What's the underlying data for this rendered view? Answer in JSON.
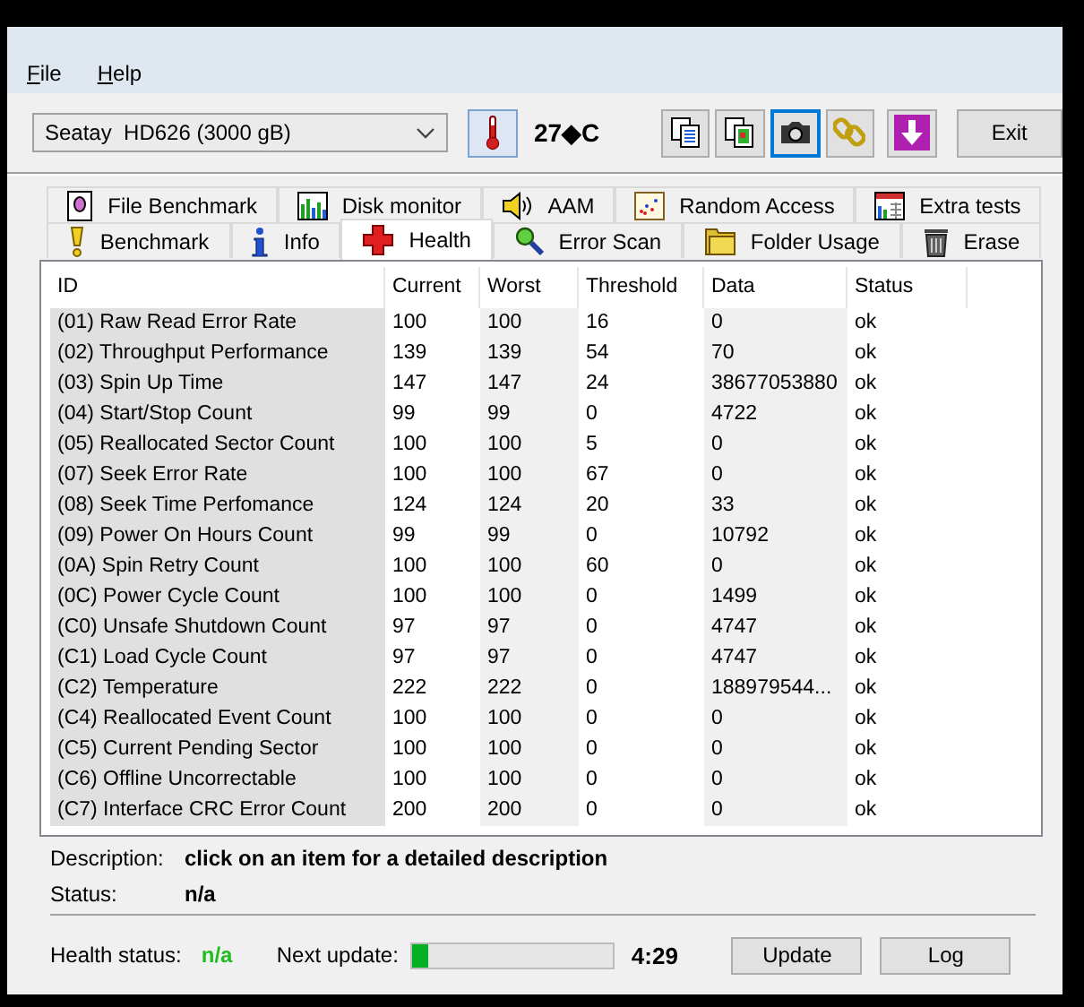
{
  "menu": [
    {
      "label": "File"
    },
    {
      "label": "Help"
    }
  ],
  "toolbar": {
    "drive": "Seatay  HD626 (3000 gB)",
    "temperature": "27◆C",
    "tools": [
      {
        "focused": false
      },
      {
        "focused": false
      },
      {
        "focused": true
      },
      {
        "focused": false
      },
      {
        "focused": false
      }
    ],
    "exit": "Exit"
  },
  "tab_rows": [
    {
      "tabs": [
        {
          "label": "File Benchmark",
          "selected": false
        },
        {
          "label": "Disk monitor",
          "selected": false
        },
        {
          "label": "AAM",
          "selected": false
        },
        {
          "label": "Random Access",
          "selected": false
        },
        {
          "label": "Extra tests",
          "selected": false
        }
      ]
    },
    {
      "tabs": [
        {
          "label": "Benchmark",
          "selected": false
        },
        {
          "label": "Info",
          "selected": false
        },
        {
          "label": "Health",
          "selected": true
        },
        {
          "label": "Error Scan",
          "selected": false
        },
        {
          "label": "Folder Usage",
          "selected": false
        },
        {
          "label": "Erase",
          "selected": false
        }
      ]
    }
  ],
  "table": {
    "columns": [
      "ID",
      "Current",
      "Worst",
      "Threshold",
      "Data",
      "Status"
    ],
    "rows": [
      [
        "(01) Raw Read Error Rate",
        "100",
        "100",
        "16",
        "0",
        "ok"
      ],
      [
        "(02) Throughput Performance",
        "139",
        "139",
        "54",
        "70",
        "ok"
      ],
      [
        "(03) Spin Up Time",
        "147",
        "147",
        "24",
        "38677053880",
        "ok"
      ],
      [
        "(04) Start/Stop Count",
        "99",
        "99",
        "0",
        "4722",
        "ok"
      ],
      [
        "(05) Reallocated Sector Count",
        "100",
        "100",
        "5",
        "0",
        "ok"
      ],
      [
        "(07) Seek Error Rate",
        "100",
        "100",
        "67",
        "0",
        "ok"
      ],
      [
        "(08) Seek Time Perfomance",
        "124",
        "124",
        "20",
        "33",
        "ok"
      ],
      [
        "(09) Power On Hours Count",
        "99",
        "99",
        "0",
        "10792",
        "ok"
      ],
      [
        "(0A) Spin Retry Count",
        "100",
        "100",
        "60",
        "0",
        "ok"
      ],
      [
        "(0C) Power Cycle Count",
        "100",
        "100",
        "0",
        "1499",
        "ok"
      ],
      [
        "(C0) Unsafe Shutdown Count",
        "97",
        "97",
        "0",
        "4747",
        "ok"
      ],
      [
        "(C1) Load Cycle Count",
        "97",
        "97",
        "0",
        "4747",
        "ok"
      ],
      [
        "(C2) Temperature",
        "222",
        "222",
        "0",
        "188979544...",
        "ok"
      ],
      [
        "(C4) Reallocated Event Count",
        "100",
        "100",
        "0",
        "0",
        "ok"
      ],
      [
        "(C5) Current Pending Sector",
        "100",
        "100",
        "0",
        "0",
        "ok"
      ],
      [
        "(C6) Offline Uncorrectable",
        "100",
        "100",
        "0",
        "0",
        "ok"
      ],
      [
        "(C7) Interface CRC Error Count",
        "200",
        "200",
        "0",
        "0",
        "ok"
      ]
    ]
  },
  "details": {
    "description_label": "Description:",
    "description": "click on an item for a detailed description",
    "status_label": "Status:",
    "status": "n/a"
  },
  "footer": {
    "health_label": "Health status:",
    "health": "n/a",
    "next_label": "Next update:",
    "progress": {
      "level": 0.08
    },
    "countdown": "4:29",
    "buttons": [
      "Update",
      "Log"
    ]
  }
}
